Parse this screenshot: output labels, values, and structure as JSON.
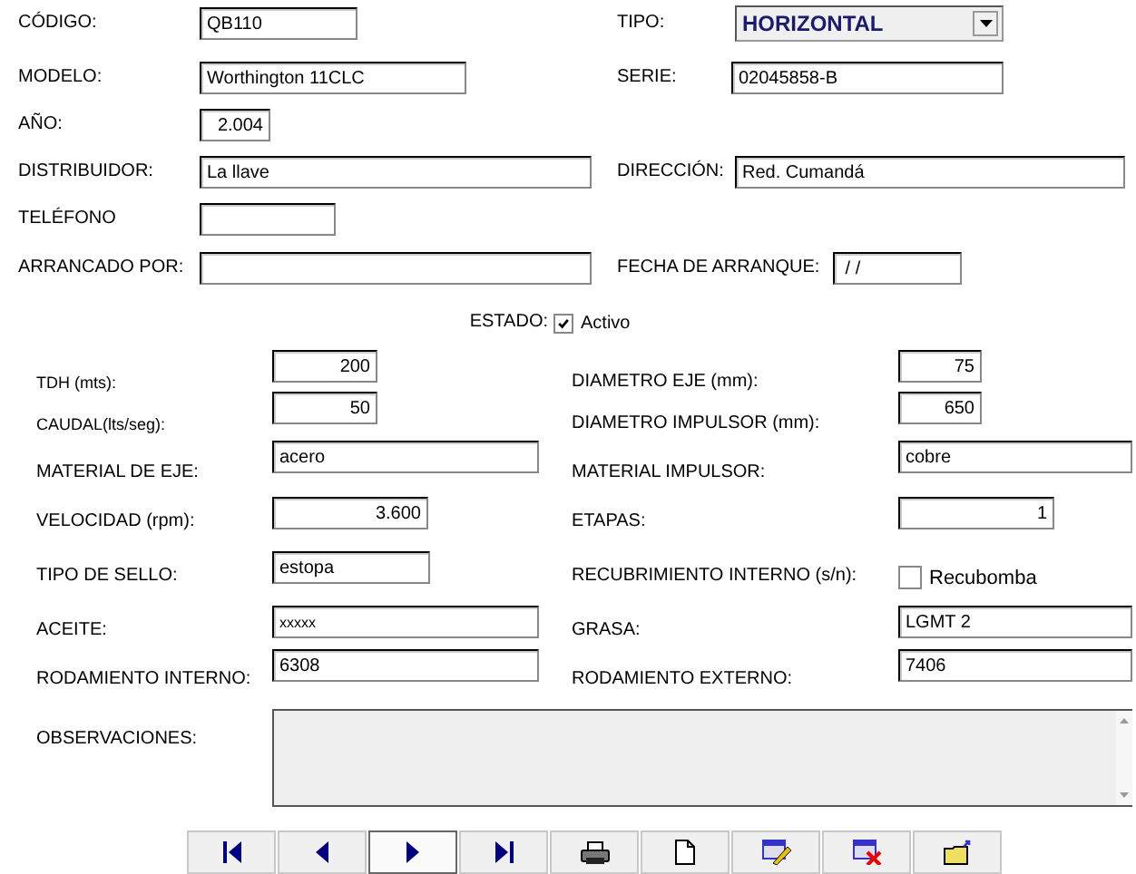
{
  "codigo": {
    "label": "CÓDIGO:",
    "value": "QB110"
  },
  "tipo": {
    "label": "TIPO:",
    "value": "HORIZONTAL"
  },
  "modelo": {
    "label": "MODELO:",
    "value": "Worthington 11CLC"
  },
  "serie": {
    "label": "SERIE:",
    "value": "02045858-B"
  },
  "anio": {
    "label": "AÑO:",
    "value": "2.004"
  },
  "distribuidor": {
    "label": "DISTRIBUIDOR:",
    "value": "La llave"
  },
  "direccion": {
    "label": "DIRECCIÓN:",
    "value": "Red. Cumandá"
  },
  "telefono": {
    "label": "TELÉFONO"
  },
  "arrancado_por": {
    "label": "ARRANCADO POR:"
  },
  "fecha_arranque": {
    "label": "FECHA DE ARRANQUE:",
    "value": " / /"
  },
  "estado": {
    "label": "ESTADO:",
    "checkbox_label": "Activo",
    "checked": true
  },
  "tdh": {
    "label": "TDH (mts):",
    "value": "200"
  },
  "diametro_eje": {
    "label": "DIAMETRO EJE (mm):",
    "value": "75"
  },
  "caudal": {
    "label": "CAUDAL(lts/seg):",
    "value": "50"
  },
  "diametro_impulsor": {
    "label": "DIAMETRO IMPULSOR (mm):",
    "value": "650"
  },
  "material_eje": {
    "label": "MATERIAL DE EJE:",
    "value": "acero"
  },
  "material_impulsor": {
    "label": "MATERIAL IMPULSOR:",
    "value": "cobre"
  },
  "velocidad": {
    "label": "VELOCIDAD (rpm):",
    "value": "3.600"
  },
  "etapas": {
    "label": "ETAPAS:",
    "value": "1"
  },
  "tipo_sello": {
    "label": "TIPO DE SELLO:",
    "value": "estopa"
  },
  "recubrimiento": {
    "label": "RECUBRIMIENTO INTERNO (s/n):",
    "checkbox_label": "Recubomba",
    "checked": false
  },
  "aceite": {
    "label": "ACEITE:",
    "value": "xxxxx"
  },
  "grasa": {
    "label": "GRASA:",
    "value": "LGMT 2"
  },
  "rodamiento_interno": {
    "label": "RODAMIENTO INTERNO:",
    "value": "6308"
  },
  "rodamiento_externo": {
    "label": "RODAMIENTO EXTERNO:",
    "value": "7406"
  },
  "observaciones": {
    "label": "OBSERVACIONES:"
  },
  "toolbar": [
    {
      "kind": "first",
      "selected": false
    },
    {
      "kind": "previous",
      "selected": false
    },
    {
      "kind": "next",
      "selected": true
    },
    {
      "kind": "last",
      "selected": false
    },
    {
      "kind": "print",
      "selected": false
    },
    {
      "kind": "new",
      "selected": false
    },
    {
      "kind": "edit",
      "selected": false
    },
    {
      "kind": "delete",
      "selected": false
    },
    {
      "kind": "open",
      "selected": false
    }
  ]
}
